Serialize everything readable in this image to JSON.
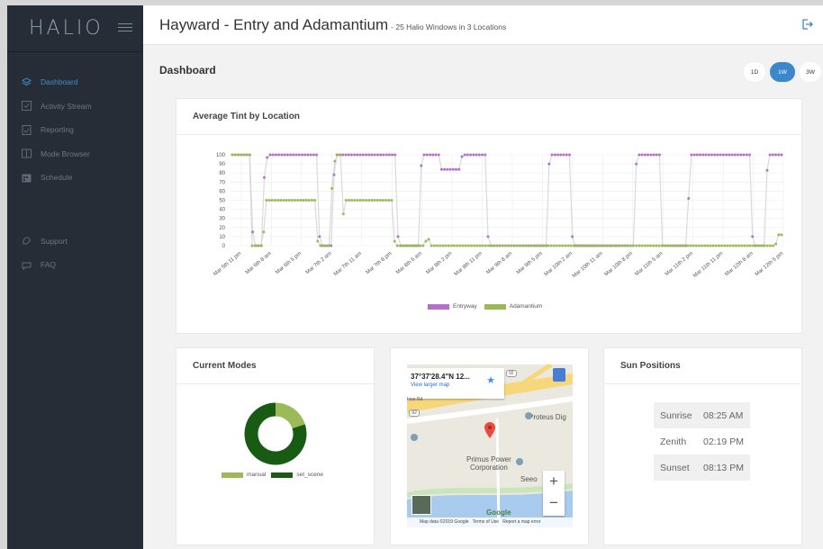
{
  "app": {
    "logo": "HALIO",
    "title": "Hayward - Entry and Adamantium",
    "subtitle": "- 25 Halio Windows in 3 Locations"
  },
  "sidebar": {
    "items": [
      {
        "label": "Dashboard",
        "icon": "dashboard-icon"
      },
      {
        "label": "Activity Stream",
        "icon": "activity-icon"
      },
      {
        "label": "Reporting",
        "icon": "reporting-icon"
      },
      {
        "label": "Mode Browser",
        "icon": "mode-browser-icon"
      },
      {
        "label": "Schedule",
        "icon": "schedule-icon"
      },
      {
        "label": "Support",
        "icon": "support-icon"
      },
      {
        "label": "FAQ",
        "icon": "faq-icon"
      }
    ]
  },
  "dashboard": {
    "title": "Dashboard",
    "ranges": [
      "1D",
      "1W",
      "3W"
    ],
    "active_range": "1W"
  },
  "tint_card": {
    "title": "Average Tint by Location"
  },
  "modes_card": {
    "title": "Current Modes"
  },
  "map_card": {
    "coords": "37°37'28.4\"N 12...",
    "view_larger": "View larger map",
    "labels": [
      "Proteus Dig",
      "Primus Power",
      "Corporation",
      "Seeo",
      "Google"
    ],
    "road_labels": [
      "Prodan",
      "92",
      "92",
      "hion Rd"
    ],
    "footer": "Map data ©2019 Google   Terms of Use   Report a map error"
  },
  "sun_card": {
    "title": "Sun Positions",
    "rows": [
      {
        "label": "Sunrise",
        "time": "08:25 AM"
      },
      {
        "label": "Zenith",
        "time": "02:19 PM"
      },
      {
        "label": "Sunset",
        "time": "08:13 PM"
      }
    ]
  },
  "colors": {
    "entryway": "#b76fcc",
    "adamantium": "#99bb55",
    "set_scene": "#175c12",
    "manual": "#9bbb58",
    "accent": "#3b87cc",
    "sidebar_bg": "#272d37"
  },
  "chart_data": [
    {
      "type": "line",
      "title": "Average Tint by Location",
      "x_ticks": [
        "Mar 5th 11 pm",
        "Mar 6th 8 am",
        "Mar 6th 5 pm",
        "Mar 7th 2 am",
        "Mar 7th 11 am",
        "Mar 7th 8 pm",
        "Mar 8th 5 am",
        "Mar 8th 2 pm",
        "Mar 8th 11 pm",
        "Mar 9th 8 am",
        "Mar 9th 5 pm",
        "Mar 10th 2 am",
        "Mar 10th 11 am",
        "Mar 10th 8 pm",
        "Mar 11th 5 am",
        "Mar 11th 2 pm",
        "Mar 11th 11 pm",
        "Mar 12th 8 am",
        "Mar 12th 5 pm"
      ],
      "ylim": [
        0,
        100
      ],
      "y_ticks": [
        0,
        10,
        20,
        30,
        40,
        50,
        60,
        70,
        80,
        90,
        100
      ],
      "grid": true,
      "legend": "bottom",
      "series": [
        {
          "name": "Entryway",
          "color": "#b76fcc",
          "values": [
            100,
            100,
            100,
            100,
            100,
            100,
            100,
            15,
            0,
            0,
            0,
            75,
            97,
            100,
            100,
            100,
            100,
            100,
            100,
            100,
            100,
            100,
            100,
            100,
            100,
            100,
            100,
            100,
            100,
            100,
            10,
            0,
            0,
            0,
            0,
            78,
            100,
            100,
            100,
            100,
            100,
            100,
            100,
            100,
            100,
            100,
            100,
            100,
            100,
            100,
            100,
            100,
            100,
            100,
            100,
            100,
            100,
            10,
            0,
            0,
            0,
            0,
            0,
            0,
            0,
            88,
            100,
            100,
            100,
            100,
            100,
            100,
            84,
            84,
            84,
            84,
            84,
            84,
            84,
            98,
            100,
            100,
            100,
            100,
            100,
            100,
            100,
            100,
            10,
            0,
            0,
            0,
            0,
            0,
            0,
            0,
            0,
            0,
            0,
            0,
            0,
            0,
            0,
            0,
            0,
            0,
            0,
            0,
            0,
            90,
            100,
            100,
            100,
            100,
            100,
            100,
            100,
            10,
            0,
            0,
            0,
            0,
            0,
            0,
            0,
            0,
            0,
            0,
            0,
            0,
            0,
            0,
            0,
            0,
            0,
            0,
            0,
            0,
            0,
            90,
            100,
            100,
            100,
            100,
            100,
            100,
            100,
            100,
            0,
            0,
            0,
            0,
            0,
            0,
            0,
            0,
            0,
            52,
            100,
            100,
            100,
            100,
            100,
            100,
            100,
            100,
            100,
            100,
            100,
            100,
            100,
            100,
            100,
            100,
            100,
            100,
            100,
            100,
            100,
            10,
            0,
            0,
            0,
            0,
            83,
            100,
            100,
            100,
            100,
            100
          ]
        },
        {
          "name": "Adamantium",
          "color": "#99bb55",
          "values": [
            100,
            100,
            100,
            100,
            100,
            100,
            100,
            0,
            0,
            0,
            0,
            15,
            50,
            50,
            50,
            50,
            50,
            50,
            50,
            50,
            50,
            50,
            50,
            50,
            50,
            50,
            50,
            50,
            50,
            50,
            5,
            0,
            0,
            0,
            0,
            63,
            93,
            100,
            100,
            35,
            50,
            50,
            50,
            50,
            50,
            50,
            50,
            50,
            50,
            50,
            50,
            50,
            50,
            50,
            50,
            50,
            50,
            5,
            0,
            0,
            0,
            0,
            0,
            0,
            0,
            0,
            0,
            0,
            5,
            7,
            0,
            0,
            0,
            0,
            0,
            0,
            0,
            0,
            0,
            0,
            0,
            0,
            0,
            0,
            0,
            0,
            0,
            0,
            0,
            0,
            0,
            0,
            0,
            0,
            0,
            0,
            0,
            0,
            0,
            0,
            0,
            0,
            0,
            0,
            0,
            0,
            0,
            0,
            0,
            0,
            0,
            0,
            0,
            0,
            0,
            0,
            0,
            0,
            0,
            0,
            0,
            0,
            0,
            0,
            0,
            0,
            0,
            0,
            0,
            0,
            0,
            0,
            0,
            0,
            0,
            0,
            0,
            0,
            0,
            0,
            0,
            0,
            0,
            0,
            0,
            0,
            0,
            0,
            0,
            0,
            0,
            0,
            0,
            0,
            0,
            0,
            0,
            0,
            0,
            0,
            0,
            0,
            0,
            0,
            0,
            0,
            0,
            0,
            0,
            0,
            0,
            0,
            0,
            0,
            0,
            0,
            0,
            0,
            0,
            0,
            0,
            0,
            0,
            0,
            0,
            0,
            0,
            0,
            0,
            0,
            0,
            2,
            12,
            12
          ]
        }
      ]
    },
    {
      "type": "pie",
      "donut": true,
      "legend": "bottom",
      "labels": [
        "manual",
        "set_scene"
      ],
      "values": [
        20,
        80
      ],
      "colors": [
        "#9bbb58",
        "#175c12"
      ]
    }
  ]
}
